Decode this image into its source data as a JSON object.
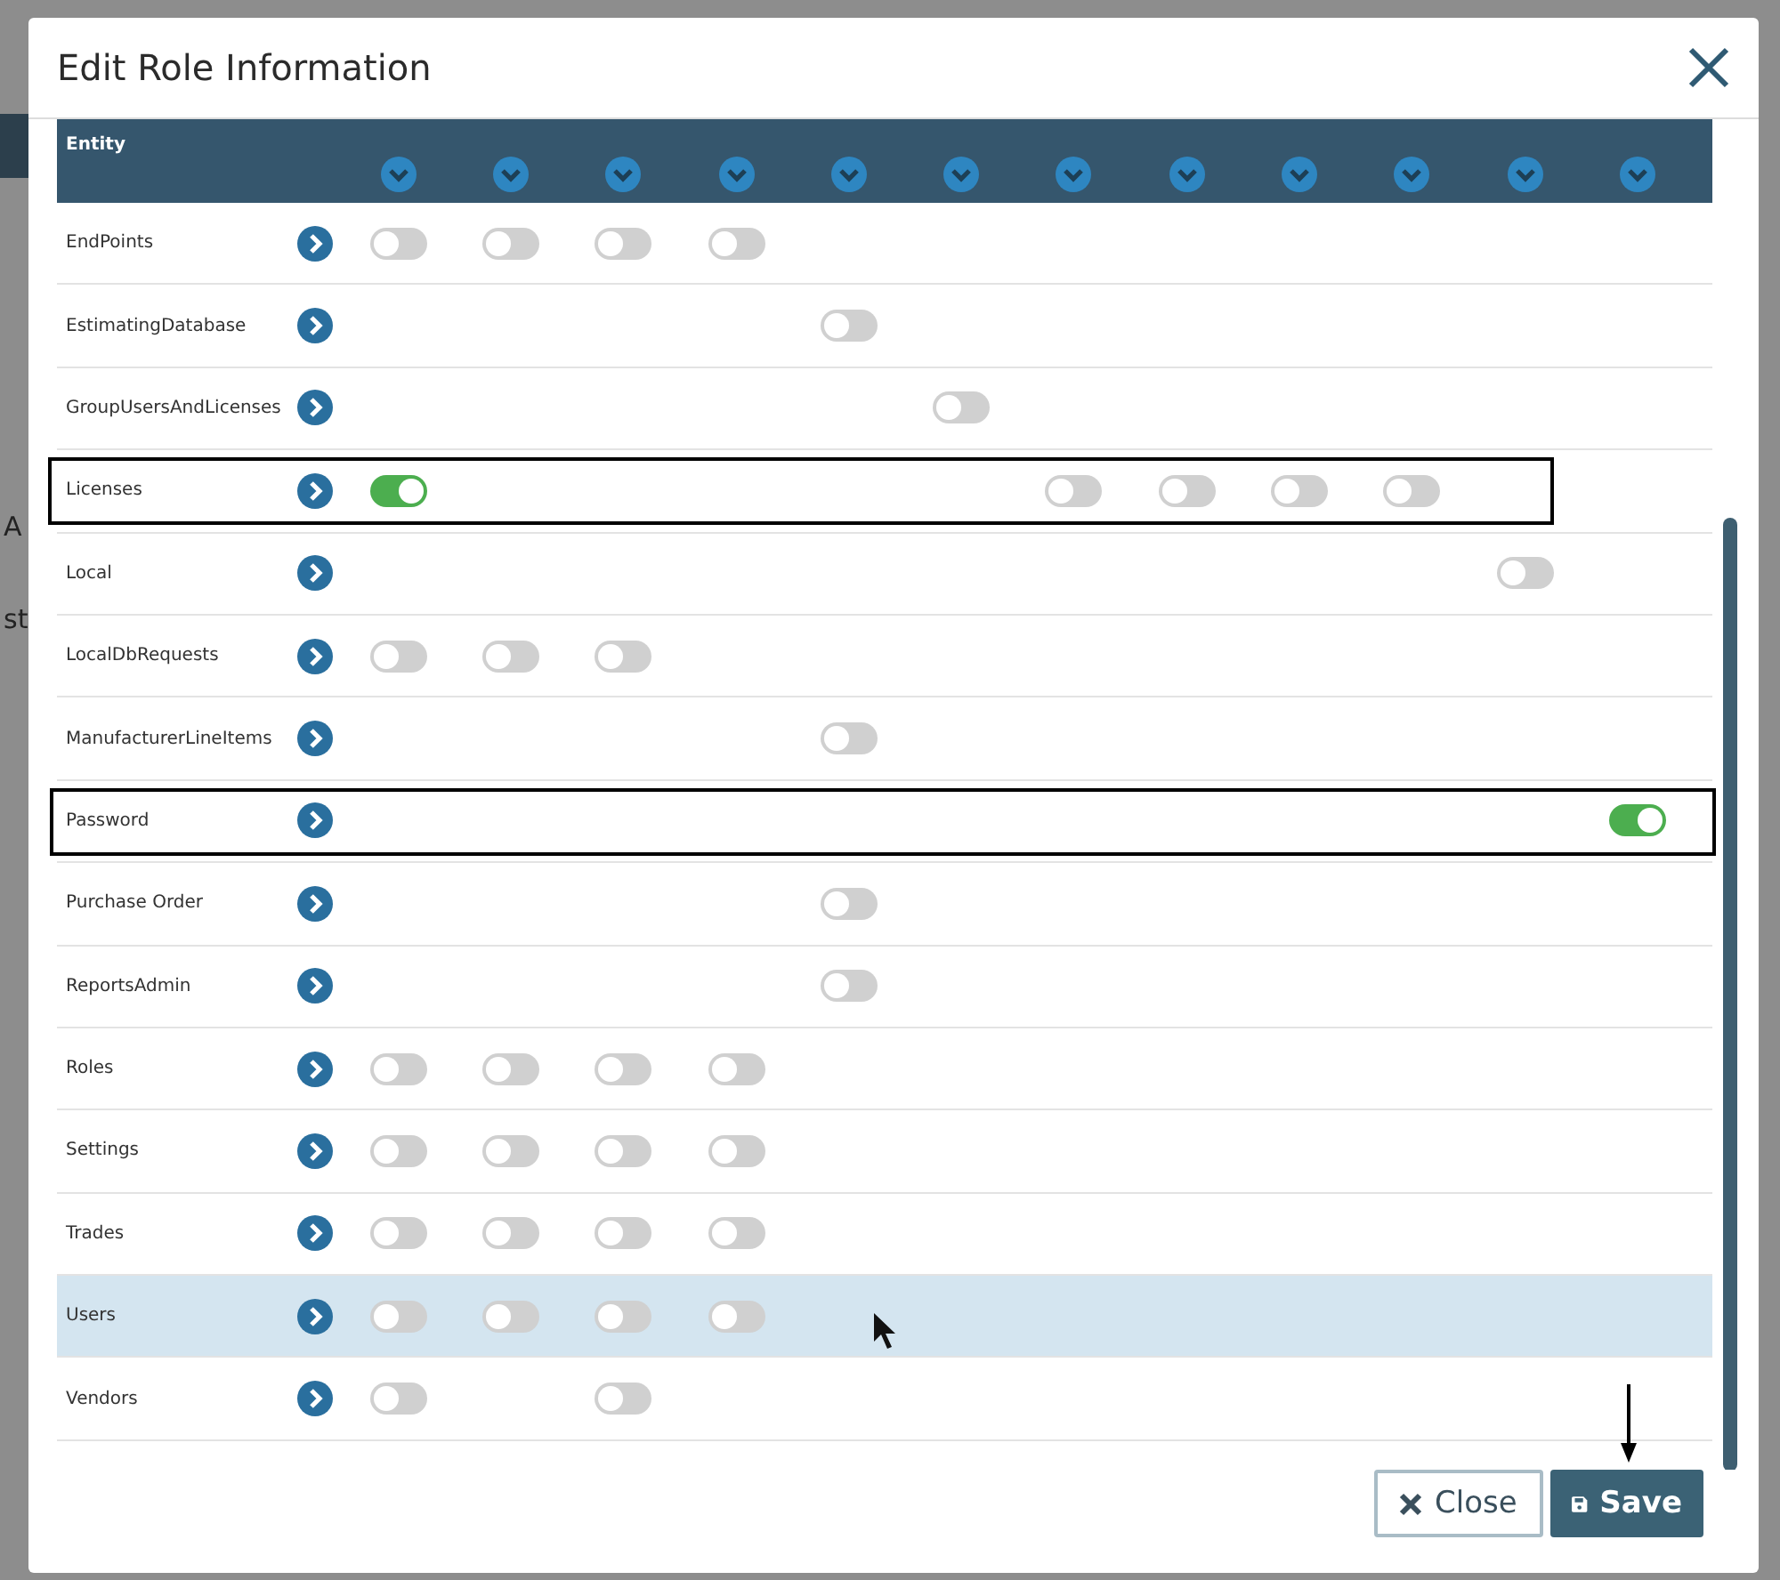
{
  "background": {
    "texts": [
      "A",
      "st"
    ]
  },
  "dialog": {
    "title": "Edit Role Information",
    "table": {
      "entity_heading": "Entity",
      "rows": [
        {
          "entity": "EndPoints",
          "selected": false,
          "outlined": false,
          "cells": [
            {
              "kind": "toggle",
              "on": false
            },
            {
              "kind": "toggle",
              "on": false
            },
            {
              "kind": "toggle",
              "on": false
            },
            {
              "kind": "toggle",
              "on": false
            },
            {
              "kind": "blank"
            },
            {
              "kind": "blank"
            },
            {
              "kind": "blank"
            },
            {
              "kind": "blank"
            },
            {
              "kind": "blank"
            },
            {
              "kind": "blank"
            },
            {
              "kind": "blank"
            },
            {
              "kind": "blank"
            }
          ]
        },
        {
          "entity": "EstimatingDatabase",
          "selected": false,
          "outlined": false,
          "cells": [
            {
              "kind": "blank"
            },
            {
              "kind": "blank"
            },
            {
              "kind": "blank"
            },
            {
              "kind": "blank"
            },
            {
              "kind": "toggle",
              "on": false
            },
            {
              "kind": "blank"
            },
            {
              "kind": "blank"
            },
            {
              "kind": "blank"
            },
            {
              "kind": "blank"
            },
            {
              "kind": "blank"
            },
            {
              "kind": "blank"
            },
            {
              "kind": "blank"
            }
          ]
        },
        {
          "entity": "GroupUsersAndLicenses",
          "selected": false,
          "outlined": false,
          "cells": [
            {
              "kind": "blank"
            },
            {
              "kind": "blank"
            },
            {
              "kind": "blank"
            },
            {
              "kind": "blank"
            },
            {
              "kind": "blank"
            },
            {
              "kind": "toggle",
              "on": false
            },
            {
              "kind": "blank"
            },
            {
              "kind": "blank"
            },
            {
              "kind": "blank"
            },
            {
              "kind": "blank"
            },
            {
              "kind": "blank"
            },
            {
              "kind": "blank"
            }
          ]
        },
        {
          "entity": "Licenses",
          "selected": false,
          "outlined": true,
          "cells": [
            {
              "kind": "toggle",
              "on": true
            },
            {
              "kind": "blank"
            },
            {
              "kind": "blank"
            },
            {
              "kind": "blank"
            },
            {
              "kind": "blank"
            },
            {
              "kind": "blank"
            },
            {
              "kind": "toggle",
              "on": false
            },
            {
              "kind": "toggle",
              "on": false
            },
            {
              "kind": "toggle",
              "on": false
            },
            {
              "kind": "toggle",
              "on": false
            },
            {
              "kind": "blank"
            },
            {
              "kind": "blank"
            }
          ]
        },
        {
          "entity": "Local",
          "selected": false,
          "outlined": false,
          "cells": [
            {
              "kind": "blank"
            },
            {
              "kind": "blank"
            },
            {
              "kind": "blank"
            },
            {
              "kind": "blank"
            },
            {
              "kind": "blank"
            },
            {
              "kind": "blank"
            },
            {
              "kind": "blank"
            },
            {
              "kind": "blank"
            },
            {
              "kind": "blank"
            },
            {
              "kind": "blank"
            },
            {
              "kind": "toggle",
              "on": false
            },
            {
              "kind": "blank"
            }
          ]
        },
        {
          "entity": "LocalDbRequests",
          "selected": false,
          "outlined": false,
          "cells": [
            {
              "kind": "toggle",
              "on": false
            },
            {
              "kind": "toggle",
              "on": false
            },
            {
              "kind": "toggle",
              "on": false
            },
            {
              "kind": "blank"
            },
            {
              "kind": "blank"
            },
            {
              "kind": "blank"
            },
            {
              "kind": "blank"
            },
            {
              "kind": "blank"
            },
            {
              "kind": "blank"
            },
            {
              "kind": "blank"
            },
            {
              "kind": "blank"
            },
            {
              "kind": "blank"
            }
          ]
        },
        {
          "entity": "ManufacturerLineItems",
          "selected": false,
          "outlined": false,
          "cells": [
            {
              "kind": "blank"
            },
            {
              "kind": "blank"
            },
            {
              "kind": "blank"
            },
            {
              "kind": "blank"
            },
            {
              "kind": "toggle",
              "on": false
            },
            {
              "kind": "blank"
            },
            {
              "kind": "blank"
            },
            {
              "kind": "blank"
            },
            {
              "kind": "blank"
            },
            {
              "kind": "blank"
            },
            {
              "kind": "blank"
            },
            {
              "kind": "blank"
            }
          ]
        },
        {
          "entity": "Password",
          "selected": false,
          "outlined": true,
          "cells": [
            {
              "kind": "blank"
            },
            {
              "kind": "blank"
            },
            {
              "kind": "blank"
            },
            {
              "kind": "blank"
            },
            {
              "kind": "blank"
            },
            {
              "kind": "blank"
            },
            {
              "kind": "blank"
            },
            {
              "kind": "blank"
            },
            {
              "kind": "blank"
            },
            {
              "kind": "blank"
            },
            {
              "kind": "blank"
            },
            {
              "kind": "toggle",
              "on": true
            }
          ]
        },
        {
          "entity": "Purchase Order",
          "selected": false,
          "outlined": false,
          "cells": [
            {
              "kind": "blank"
            },
            {
              "kind": "blank"
            },
            {
              "kind": "blank"
            },
            {
              "kind": "blank"
            },
            {
              "kind": "toggle",
              "on": false
            },
            {
              "kind": "blank"
            },
            {
              "kind": "blank"
            },
            {
              "kind": "blank"
            },
            {
              "kind": "blank"
            },
            {
              "kind": "blank"
            },
            {
              "kind": "blank"
            },
            {
              "kind": "blank"
            }
          ]
        },
        {
          "entity": "ReportsAdmin",
          "selected": false,
          "outlined": false,
          "cells": [
            {
              "kind": "blank"
            },
            {
              "kind": "blank"
            },
            {
              "kind": "blank"
            },
            {
              "kind": "blank"
            },
            {
              "kind": "toggle",
              "on": false
            },
            {
              "kind": "blank"
            },
            {
              "kind": "blank"
            },
            {
              "kind": "blank"
            },
            {
              "kind": "blank"
            },
            {
              "kind": "blank"
            },
            {
              "kind": "blank"
            },
            {
              "kind": "blank"
            }
          ]
        },
        {
          "entity": "Roles",
          "selected": false,
          "outlined": false,
          "cells": [
            {
              "kind": "toggle",
              "on": false
            },
            {
              "kind": "toggle",
              "on": false
            },
            {
              "kind": "toggle",
              "on": false
            },
            {
              "kind": "toggle",
              "on": false
            },
            {
              "kind": "blank"
            },
            {
              "kind": "blank"
            },
            {
              "kind": "blank"
            },
            {
              "kind": "blank"
            },
            {
              "kind": "blank"
            },
            {
              "kind": "blank"
            },
            {
              "kind": "blank"
            },
            {
              "kind": "blank"
            }
          ]
        },
        {
          "entity": "Settings",
          "selected": false,
          "outlined": false,
          "cells": [
            {
              "kind": "toggle",
              "on": false
            },
            {
              "kind": "toggle",
              "on": false
            },
            {
              "kind": "toggle",
              "on": false
            },
            {
              "kind": "toggle",
              "on": false
            },
            {
              "kind": "blank"
            },
            {
              "kind": "blank"
            },
            {
              "kind": "blank"
            },
            {
              "kind": "blank"
            },
            {
              "kind": "blank"
            },
            {
              "kind": "blank"
            },
            {
              "kind": "blank"
            },
            {
              "kind": "blank"
            }
          ]
        },
        {
          "entity": "Trades",
          "selected": false,
          "outlined": false,
          "cells": [
            {
              "kind": "toggle",
              "on": false
            },
            {
              "kind": "toggle",
              "on": false
            },
            {
              "kind": "toggle",
              "on": false
            },
            {
              "kind": "toggle",
              "on": false
            },
            {
              "kind": "blank"
            },
            {
              "kind": "blank"
            },
            {
              "kind": "blank"
            },
            {
              "kind": "blank"
            },
            {
              "kind": "blank"
            },
            {
              "kind": "blank"
            },
            {
              "kind": "blank"
            },
            {
              "kind": "blank"
            }
          ]
        },
        {
          "entity": "Users",
          "selected": true,
          "outlined": false,
          "cells": [
            {
              "kind": "toggle",
              "on": false
            },
            {
              "kind": "toggle",
              "on": false
            },
            {
              "kind": "toggle",
              "on": false
            },
            {
              "kind": "toggle",
              "on": false
            },
            {
              "kind": "blank"
            },
            {
              "kind": "blank"
            },
            {
              "kind": "blank"
            },
            {
              "kind": "blank"
            },
            {
              "kind": "blank"
            },
            {
              "kind": "blank"
            },
            {
              "kind": "blank"
            },
            {
              "kind": "blank"
            }
          ]
        },
        {
          "entity": "Vendors",
          "selected": false,
          "outlined": false,
          "cells": [
            {
              "kind": "toggle",
              "on": false
            },
            {
              "kind": "blank"
            },
            {
              "kind": "toggle",
              "on": false
            },
            {
              "kind": "blank"
            },
            {
              "kind": "blank"
            },
            {
              "kind": "blank"
            },
            {
              "kind": "blank"
            },
            {
              "kind": "blank"
            },
            {
              "kind": "blank"
            },
            {
              "kind": "blank"
            },
            {
              "kind": "blank"
            },
            {
              "kind": "blank"
            }
          ]
        }
      ]
    },
    "buttons": [
      {
        "kind": "close",
        "label": "Close"
      },
      {
        "kind": "save",
        "label": "Save"
      }
    ]
  }
}
